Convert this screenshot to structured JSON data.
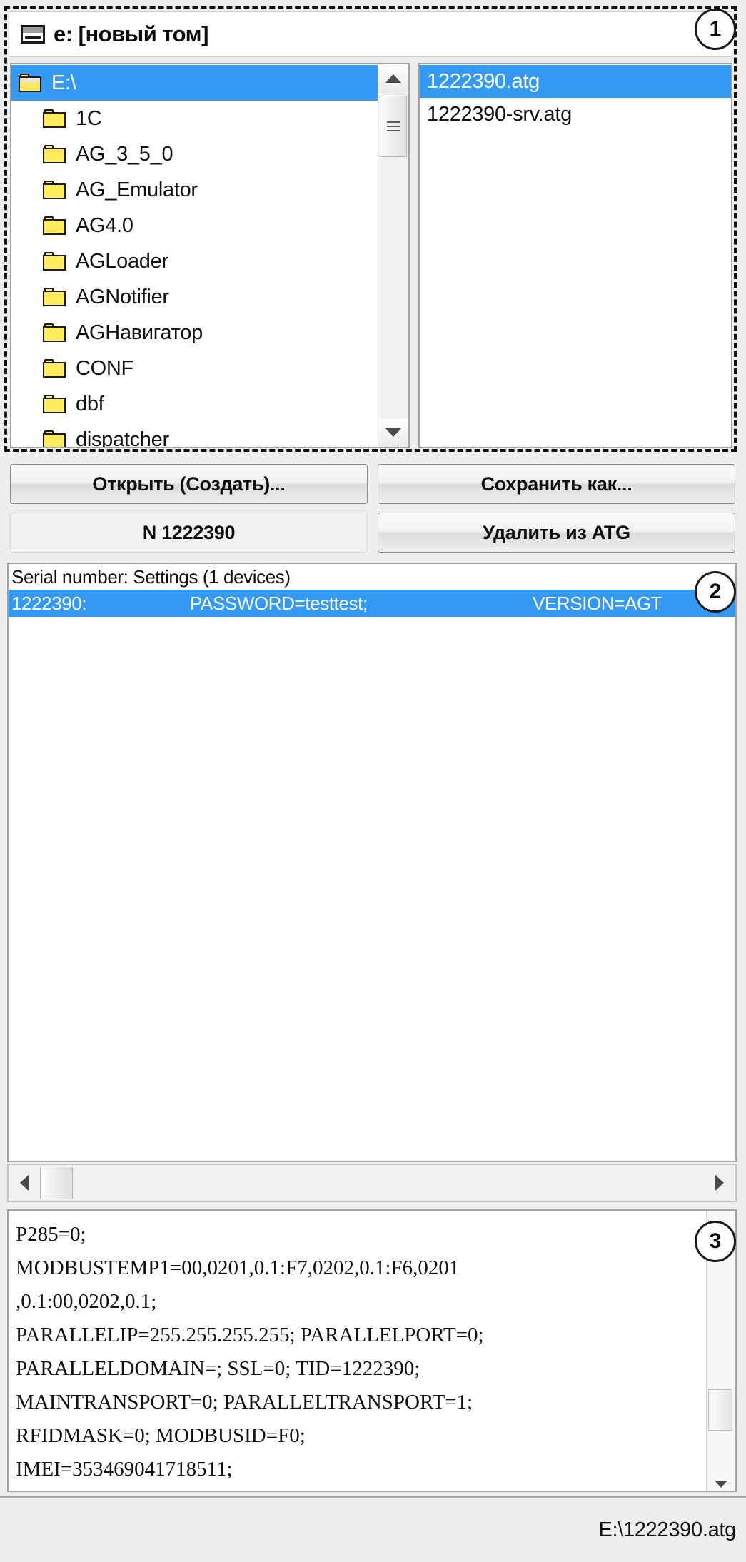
{
  "window": {
    "title": "e: [новый том]",
    "drive_icon": "drive-icon"
  },
  "file_browser": {
    "tree": [
      {
        "label": "E:\\",
        "icon": "open-folder-icon",
        "selected": true,
        "root": true
      },
      {
        "label": "1C",
        "icon": "folder-icon",
        "selected": false,
        "root": false
      },
      {
        "label": "AG_3_5_0",
        "icon": "folder-icon",
        "selected": false,
        "root": false
      },
      {
        "label": "AG_Emulator",
        "icon": "folder-icon",
        "selected": false,
        "root": false
      },
      {
        "label": "AG4.0",
        "icon": "folder-icon",
        "selected": false,
        "root": false
      },
      {
        "label": "AGLoader",
        "icon": "folder-icon",
        "selected": false,
        "root": false
      },
      {
        "label": "AGNotifier",
        "icon": "folder-icon",
        "selected": false,
        "root": false
      },
      {
        "label": "AGНавигатор",
        "icon": "folder-icon",
        "selected": false,
        "root": false
      },
      {
        "label": "CONF",
        "icon": "folder-icon",
        "selected": false,
        "root": false
      },
      {
        "label": "dbf",
        "icon": "folder-icon",
        "selected": false,
        "root": false
      },
      {
        "label": "dispatcher",
        "icon": "folder-icon",
        "selected": false,
        "root": false
      }
    ],
    "files": [
      {
        "label": "1222390.atg",
        "selected": true
      },
      {
        "label": "1222390-srv.atg",
        "selected": false
      }
    ]
  },
  "buttons": {
    "open_create": "Открыть (Создать)...",
    "save_as": "Сохранить как...",
    "serial_display": "N 1222390",
    "delete_from_atg": "Удалить из ATG"
  },
  "settings_list": {
    "header": "Serial number: Settings (1 devices)",
    "rows": [
      {
        "serial": "1222390:",
        "password": "PASSWORD=testtest;",
        "version": "VERSION=AGT",
        "selected": true
      }
    ]
  },
  "config_text": "P285=0;\nMODBUSTEMP1=00,0201,0.1:F7,0202,0.1:F6,0201\n,0.1:00,0202,0.1;\nPARALLELIP=255.255.255.255; PARALLELPORT=0;\nPARALLELDOMAIN=; SSL=0; TID=1222390;\nMAINTRANSPORT=0; PARALLELTRANSPORT=1;\nRFIDMASK=0; MODBUSID=F0;\nIMEI=353469041718511;",
  "status_bar": {
    "path": "E:\\1222390.atg"
  },
  "callouts": {
    "one": "1",
    "two": "2",
    "three": "3"
  },
  "colors": {
    "selection_blue": "#3399f3",
    "folder_yellow": "#ffeb5c",
    "window_face": "#f0eeec",
    "border_gray": "#9fa3a7"
  }
}
